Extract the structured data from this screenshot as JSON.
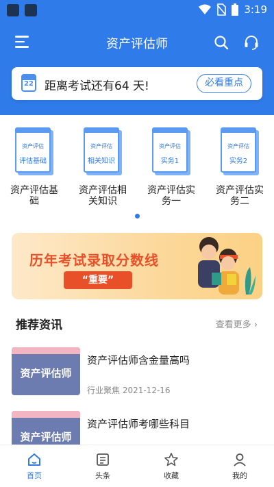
{
  "status_bar": {
    "time": "3:19"
  },
  "header": {
    "title": "资产评估师"
  },
  "countdown": {
    "day": "22",
    "text": "距离考试还有64 天!",
    "button": "必看重点"
  },
  "categories": [
    {
      "book_top": "资产评估",
      "book_bottom": "评估基础",
      "label": "资产评估基础"
    },
    {
      "book_top": "资产评估",
      "book_bottom": "相关知识",
      "label": "资产评估相关知识"
    },
    {
      "book_top": "资产评估",
      "book_bottom": "实务1",
      "label": "资产评估实务一"
    },
    {
      "book_top": "资产评估",
      "book_bottom": "实务2",
      "label": "资产评估实务二"
    }
  ],
  "banner": {
    "title": "历年考试录取分数线",
    "tag": "“重要”"
  },
  "recommend": {
    "title": "推荐资讯",
    "more": "查看更多"
  },
  "news": [
    {
      "thumb_text": "资产评估师",
      "title": "资产评估师含金量高吗",
      "meta": "行业聚焦  2021-12-16"
    },
    {
      "thumb_text": "资产评估师",
      "title": "资产评估师考哪些科目",
      "meta": ""
    }
  ],
  "tabs": [
    {
      "label": "首页",
      "active": true
    },
    {
      "label": "头条",
      "active": false
    },
    {
      "label": "收藏",
      "active": false
    },
    {
      "label": "我的",
      "active": false
    }
  ],
  "colors": {
    "primary": "#2f7be9",
    "banner_accent": "#e8502a"
  }
}
